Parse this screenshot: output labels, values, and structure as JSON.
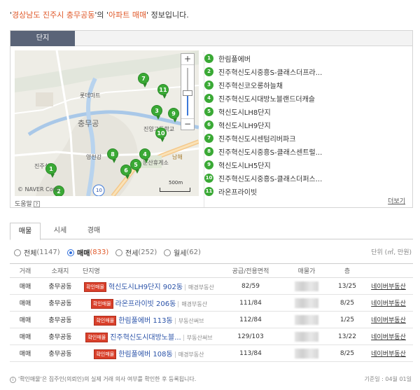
{
  "headline": {
    "quote_open": "'",
    "region": "경상남도 진주시 충무공동",
    "mid": "'의 '",
    "type": "아파트 매매",
    "tail": "' 정보입니다."
  },
  "panel": {
    "tab_label": "단지",
    "help_label": "도움말",
    "help_icon": "?",
    "more_label": "더보기"
  },
  "map": {
    "copyright": "© NAVER Corp.",
    "scale": "500m",
    "labels": {
      "lotte": "롯데마트",
      "chungmu": "충무공",
      "yeongcheon": "영천강",
      "jinyang": "진양고등학교",
      "munsan": "문산휴게소",
      "jinju_sil": "진주실",
      "jinju_tree": "진주혁신\n클베이드파",
      "route10": "10",
      "nam": "남해"
    },
    "zoom_in": "+",
    "zoom_out": "−",
    "pins": [
      {
        "n": "1"
      },
      {
        "n": "2"
      },
      {
        "n": "3"
      },
      {
        "n": "4"
      },
      {
        "n": "5"
      },
      {
        "n": "6"
      },
      {
        "n": "7"
      },
      {
        "n": "8"
      },
      {
        "n": "9"
      },
      {
        "n": "10"
      },
      {
        "n": "11"
      }
    ]
  },
  "complexes": [
    {
      "n": "1",
      "name": "한림풀에버"
    },
    {
      "n": "2",
      "name": "진주혁신도시중흥S-클래스더프라..."
    },
    {
      "n": "3",
      "name": "진주혁신코오롱하늘채"
    },
    {
      "n": "4",
      "name": "진주혁신도시대방노블랜드더캐슬"
    },
    {
      "n": "5",
      "name": "혁신도시LH8단지"
    },
    {
      "n": "6",
      "name": "혁신도시LH9단지"
    },
    {
      "n": "7",
      "name": "진주혁신도시센텀리버파크"
    },
    {
      "n": "8",
      "name": "진주혁신도시중흥S-클래스센트럴..."
    },
    {
      "n": "9",
      "name": "혁신도시LH5단지"
    },
    {
      "n": "10",
      "name": "진주혁신도시중흥S-클래스더퍼스..."
    },
    {
      "n": "11",
      "name": "라온프라이빗"
    }
  ],
  "trade_tabs": [
    "매물",
    "시세",
    "경매"
  ],
  "filters": [
    {
      "label": "전체",
      "count": "(1147)",
      "selected": false
    },
    {
      "label": "매매",
      "count": "(833)",
      "selected": true
    },
    {
      "label": "전세",
      "count": "(252)",
      "selected": false
    },
    {
      "label": "월세",
      "count": "(62)",
      "selected": false
    }
  ],
  "unit_label": "단위 (㎡, 만원)",
  "table": {
    "headers": [
      "거래",
      "소재지",
      "단지명",
      "공급/전용면적",
      "매물가",
      "층",
      "정보제공"
    ],
    "rows": [
      {
        "deal": "매매",
        "loc": "충무공동",
        "badge": "확인매물",
        "name": "혁신도시LH9단지 902동",
        "agent": "매경부동산",
        "area": "82/59",
        "floor": "13/25",
        "provider": "네이버부동산"
      },
      {
        "deal": "매매",
        "loc": "충무공동",
        "badge": "확인매물",
        "name": "라온프라이빗 206동",
        "agent": "매경부동산",
        "area": "111/84",
        "floor": "8/25",
        "provider": "네이버부동산"
      },
      {
        "deal": "매매",
        "loc": "충무공동",
        "badge": "확인매물",
        "name": "한림풀에버 113동",
        "agent": "부동산써브",
        "area": "112/84",
        "floor": "1/25",
        "provider": "네이버부동산"
      },
      {
        "deal": "매매",
        "loc": "충무공동",
        "badge": "확인매물",
        "name": "진주혁신도시대방노블...",
        "agent": "부동산써브",
        "area": "129/103",
        "floor": "13/22",
        "provider": "네이버부동산"
      },
      {
        "deal": "매매",
        "loc": "충무공동",
        "badge": "확인매물",
        "name": "한림풀에버 108동",
        "agent": "매경부동산",
        "area": "113/84",
        "floor": "8/25",
        "provider": "네이버부동산"
      }
    ]
  },
  "footnote": "'확인매물'은 집주인(의뢰인)의 실제 거래 의사 여부를 확인한 후 등록됩니다.",
  "footnote_icon": "i",
  "base_date": "기준일 : 04월 01일",
  "colors": {
    "accent": "#e05a2b",
    "pin": "#3aa935",
    "badge": "#d9402b",
    "tab": "#5a6478"
  }
}
